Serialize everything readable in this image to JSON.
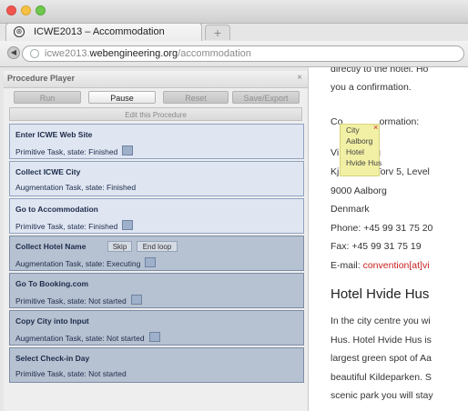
{
  "window": {
    "tab_title": "ICWE2013 – Accommodation",
    "new_tab": "+"
  },
  "address": {
    "scheme": "icwe2013.",
    "host": "webengineering.org",
    "path": "/accommodation"
  },
  "player": {
    "title": "Procedure Player",
    "close": "×",
    "buttons": {
      "run": "Run",
      "pause": "Pause",
      "reset": "Reset",
      "save": "Save/Export"
    },
    "edit": "Edit this Procedure",
    "tasks": [
      {
        "name": "Enter ICWE Web Site",
        "state": "Primitive Task, state: Finished",
        "icon": true
      },
      {
        "name": "Collect ICWE City",
        "state": "Augmentation Task, state: Finished",
        "icon": false
      },
      {
        "name": "Go to Accommodation",
        "state": "Primitive Task, state: Finished",
        "icon": true
      },
      {
        "name": "Collect Hotel Name",
        "state": "Augmentation Task, state: Executing",
        "icon": true,
        "actions": [
          "Skip",
          "End loop"
        ]
      },
      {
        "name": "Go To Booking.com",
        "state": "Primitive Task, state: Not started",
        "icon": true
      },
      {
        "name": "Copy City into Input",
        "state": "Augmentation Task, state: Not started",
        "icon": true
      },
      {
        "name": "Select Check-in Day",
        "state": "Primitive Task, state: Not started",
        "icon": false
      }
    ]
  },
  "page": {
    "line1": "directly to the hotel. Ho",
    "line2": "you a confirmation.",
    "contact_prefix": "Co",
    "contact_suffix": "ormation:",
    "vi": "Vi",
    "g": "g",
    "kj": "Kj",
    "hus": "Hus",
    "addr_tail": "Torv 5, Level",
    "city": "9000 Aalborg",
    "country": "Denmark",
    "phone": "Phone: +45 99 31 75 20",
    "fax": "Fax: +45 99 31 75 19",
    "email_prefix": "E-mail: ",
    "email_link": "convention[at]vi",
    "heading": "Hotel Hvide Hus",
    "p1": "In the city centre you wi",
    "p2": "Hus. Hotel Hvide Hus is",
    "p3": "largest green spot of Aa",
    "p4": "beautiful Kildeparken. S",
    "p5": "scenic park you will stay"
  },
  "tooltip": {
    "lines": [
      "City",
      "Aalborg",
      "Hotel",
      "Hvide Hus"
    ],
    "close": "×"
  }
}
